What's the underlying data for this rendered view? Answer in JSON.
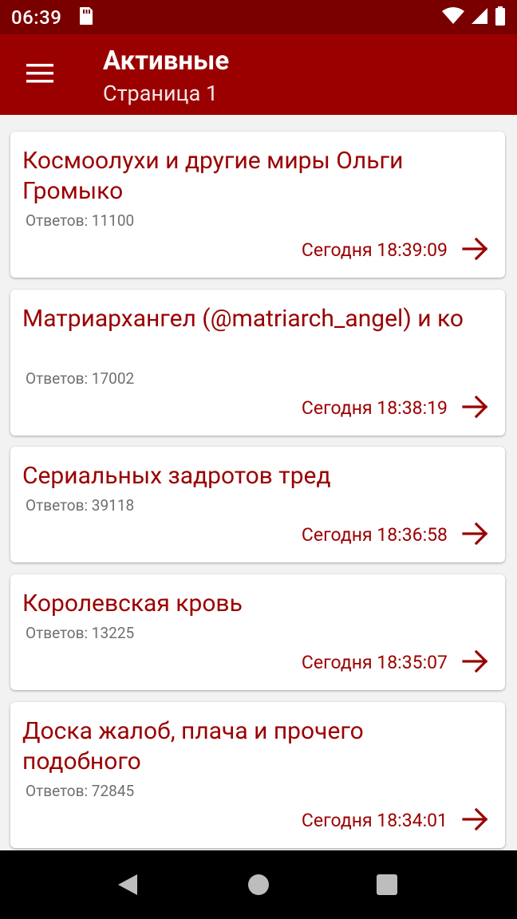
{
  "status_bar": {
    "time": "06:39",
    "icons": [
      "sd-card-icon",
      "wifi-icon",
      "signal-icon",
      "battery-icon"
    ]
  },
  "app_bar": {
    "title": "Активные",
    "subtitle": "Страница 1",
    "menu_icon": "hamburger-menu-icon"
  },
  "threads": [
    {
      "title": "Космоолухи и другие миры Ольги Громыко",
      "replies": "Ответов: 11100",
      "time": "Сегодня 18:39:09"
    },
    {
      "title": "Матриархангел (@matriarch_angel) и ко",
      "replies": "Ответов: 17002",
      "time": "Сегодня 18:38:19"
    },
    {
      "title": "Сериальных задротов тред",
      "replies": "Ответов: 39118",
      "time": "Сегодня 18:36:58"
    },
    {
      "title": "Королевская кровь",
      "replies": "Ответов: 13225",
      "time": "Сегодня 18:35:07"
    },
    {
      "title": "Доска жалоб, плача и прочего подобного",
      "replies": "Ответов: 72845",
      "time": "Сегодня 18:34:01"
    }
  ],
  "colors": {
    "status_bar": "#7a0000",
    "app_bar": "#9b0000",
    "accent_text": "#9b0000",
    "secondary_text": "#6f6f6f",
    "background": "#f2f2f2"
  }
}
